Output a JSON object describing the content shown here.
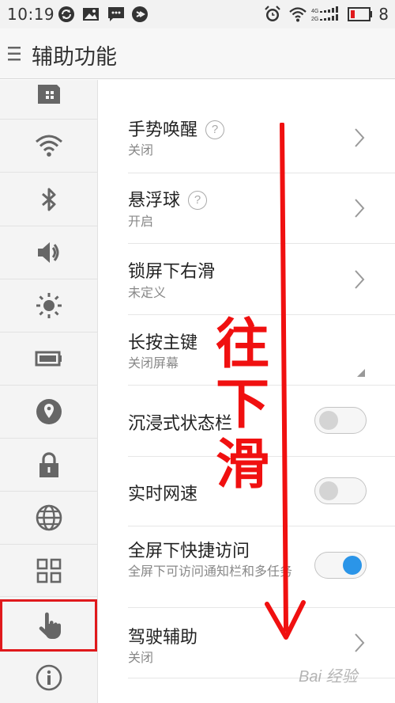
{
  "status_bar": {
    "time": "10:19",
    "page_indicator": "8",
    "icons": [
      "sync-icon",
      "image-icon",
      "message-icon",
      "security-icon",
      "alarm-icon",
      "wifi-icon",
      "signal-icon",
      "battery-icon"
    ],
    "signal_labels": [
      "4G",
      "2G"
    ]
  },
  "header": {
    "title": "辅助功能"
  },
  "sidebar": {
    "items": [
      {
        "icon": "sim-card-icon"
      },
      {
        "icon": "wifi-icon"
      },
      {
        "icon": "bluetooth-icon"
      },
      {
        "icon": "volume-icon"
      },
      {
        "icon": "brightness-icon"
      },
      {
        "icon": "battery-icon"
      },
      {
        "icon": "location-icon"
      },
      {
        "icon": "lock-icon"
      },
      {
        "icon": "globe-icon"
      },
      {
        "icon": "apps-grid-icon"
      },
      {
        "icon": "hand-gesture-icon",
        "selected": true
      },
      {
        "icon": "info-icon"
      }
    ]
  },
  "settings": {
    "gesture_wake": {
      "label": "手势唤醒",
      "value": "关闭",
      "help": "?"
    },
    "floating_ball": {
      "label": "悬浮球",
      "value": "开启",
      "help": "?"
    },
    "lock_swipe_right": {
      "label": "锁屏下右滑",
      "value": "未定义"
    },
    "long_press_home": {
      "label": "长按主键",
      "value": "关闭屏幕"
    },
    "immersive_status_bar": {
      "label": "沉浸式状态栏",
      "enabled": false
    },
    "realtime_network_speed": {
      "label": "实时网速",
      "enabled": false
    },
    "fullscreen_quick_access": {
      "label": "全屏下快捷访问",
      "description": "全屏下可访问通知栏和多任务",
      "enabled": true
    },
    "driving_assist": {
      "label": "驾驶辅助",
      "value": "关闭"
    }
  },
  "overlay": {
    "annotation_chars": [
      "往",
      "下",
      "滑"
    ],
    "annotation_color": "#f01010"
  },
  "watermark": {
    "text": "Bai 经验"
  },
  "colors": {
    "accent": "#2b95e8",
    "highlight": "#e0191c"
  }
}
